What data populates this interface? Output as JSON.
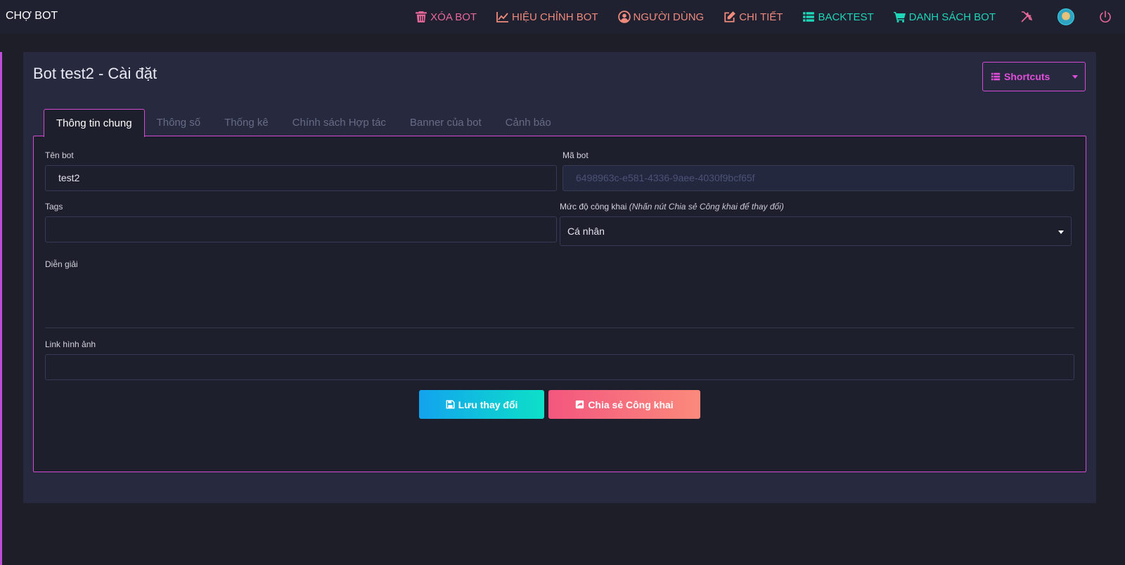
{
  "app": {
    "brand": "CHỢ BOT"
  },
  "nav": {
    "delete_bot": "XÓA BOT",
    "edit_bot": "HIỆU CHỈNH BOT",
    "users": "NGƯỜI DÙNG",
    "details": "CHI TIẾT",
    "backtest": "BACKTEST",
    "bot_list": "DANH SÁCH BOT",
    "icons": [
      "trash-icon",
      "chart-line-icon",
      "user-circle-icon",
      "edit-icon",
      "list-icon",
      "cart-icon",
      "tools-icon",
      "avatar",
      "power-icon"
    ]
  },
  "page": {
    "title": "Bot test2 - Cài đặt",
    "shortcuts_label": "Shortcuts"
  },
  "tabs": [
    {
      "label": "Thông tin chung",
      "active": true
    },
    {
      "label": "Thông số",
      "active": false
    },
    {
      "label": "Thống kê",
      "active": false
    },
    {
      "label": "Chính sách Hợp tác",
      "active": false
    },
    {
      "label": "Banner của bot",
      "active": false
    },
    {
      "label": "Cảnh báo",
      "active": false
    }
  ],
  "form": {
    "bot_name_label": "Tên bot",
    "bot_name_value": "test2",
    "bot_code_label": "Mã bot",
    "bot_code_value": "6498963c-e581-4336-9aee-4030f9bcf65f",
    "tags_label": "Tags",
    "tags_value": "",
    "visibility_label": "Mức độ công khai",
    "visibility_hint": "(Nhấn nút Chia sẻ Công khai để thay đổi)",
    "visibility_value": "Cá nhân",
    "description_label": "Diễn giải",
    "image_link_label": "Link hình ảnh",
    "image_link_value": ""
  },
  "buttons": {
    "save": "Lưu thay đổi",
    "share": "Chia sẻ Công khai"
  },
  "colors": {
    "accent": "#d64ad6",
    "pink": "#e9689a",
    "coral": "#ef8a7c",
    "teal": "#1fd6b8",
    "background": "#1d1e28",
    "card": "#272a3e"
  }
}
